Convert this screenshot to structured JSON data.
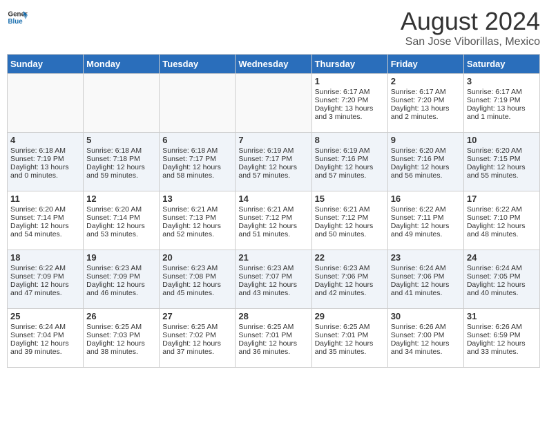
{
  "logo": {
    "general": "General",
    "blue": "Blue"
  },
  "title": "August 2024",
  "subtitle": "San Jose Viborillas, Mexico",
  "headers": [
    "Sunday",
    "Monday",
    "Tuesday",
    "Wednesday",
    "Thursday",
    "Friday",
    "Saturday"
  ],
  "weeks": [
    [
      {
        "day": "",
        "text": ""
      },
      {
        "day": "",
        "text": ""
      },
      {
        "day": "",
        "text": ""
      },
      {
        "day": "",
        "text": ""
      },
      {
        "day": "1",
        "text": "Sunrise: 6:17 AM\nSunset: 7:20 PM\nDaylight: 13 hours\nand 3 minutes."
      },
      {
        "day": "2",
        "text": "Sunrise: 6:17 AM\nSunset: 7:20 PM\nDaylight: 13 hours\nand 2 minutes."
      },
      {
        "day": "3",
        "text": "Sunrise: 6:17 AM\nSunset: 7:19 PM\nDaylight: 13 hours\nand 1 minute."
      }
    ],
    [
      {
        "day": "4",
        "text": "Sunrise: 6:18 AM\nSunset: 7:19 PM\nDaylight: 13 hours\nand 0 minutes."
      },
      {
        "day": "5",
        "text": "Sunrise: 6:18 AM\nSunset: 7:18 PM\nDaylight: 12 hours\nand 59 minutes."
      },
      {
        "day": "6",
        "text": "Sunrise: 6:18 AM\nSunset: 7:17 PM\nDaylight: 12 hours\nand 58 minutes."
      },
      {
        "day": "7",
        "text": "Sunrise: 6:19 AM\nSunset: 7:17 PM\nDaylight: 12 hours\nand 57 minutes."
      },
      {
        "day": "8",
        "text": "Sunrise: 6:19 AM\nSunset: 7:16 PM\nDaylight: 12 hours\nand 57 minutes."
      },
      {
        "day": "9",
        "text": "Sunrise: 6:20 AM\nSunset: 7:16 PM\nDaylight: 12 hours\nand 56 minutes."
      },
      {
        "day": "10",
        "text": "Sunrise: 6:20 AM\nSunset: 7:15 PM\nDaylight: 12 hours\nand 55 minutes."
      }
    ],
    [
      {
        "day": "11",
        "text": "Sunrise: 6:20 AM\nSunset: 7:14 PM\nDaylight: 12 hours\nand 54 minutes."
      },
      {
        "day": "12",
        "text": "Sunrise: 6:20 AM\nSunset: 7:14 PM\nDaylight: 12 hours\nand 53 minutes."
      },
      {
        "day": "13",
        "text": "Sunrise: 6:21 AM\nSunset: 7:13 PM\nDaylight: 12 hours\nand 52 minutes."
      },
      {
        "day": "14",
        "text": "Sunrise: 6:21 AM\nSunset: 7:12 PM\nDaylight: 12 hours\nand 51 minutes."
      },
      {
        "day": "15",
        "text": "Sunrise: 6:21 AM\nSunset: 7:12 PM\nDaylight: 12 hours\nand 50 minutes."
      },
      {
        "day": "16",
        "text": "Sunrise: 6:22 AM\nSunset: 7:11 PM\nDaylight: 12 hours\nand 49 minutes."
      },
      {
        "day": "17",
        "text": "Sunrise: 6:22 AM\nSunset: 7:10 PM\nDaylight: 12 hours\nand 48 minutes."
      }
    ],
    [
      {
        "day": "18",
        "text": "Sunrise: 6:22 AM\nSunset: 7:09 PM\nDaylight: 12 hours\nand 47 minutes."
      },
      {
        "day": "19",
        "text": "Sunrise: 6:23 AM\nSunset: 7:09 PM\nDaylight: 12 hours\nand 46 minutes."
      },
      {
        "day": "20",
        "text": "Sunrise: 6:23 AM\nSunset: 7:08 PM\nDaylight: 12 hours\nand 45 minutes."
      },
      {
        "day": "21",
        "text": "Sunrise: 6:23 AM\nSunset: 7:07 PM\nDaylight: 12 hours\nand 43 minutes."
      },
      {
        "day": "22",
        "text": "Sunrise: 6:23 AM\nSunset: 7:06 PM\nDaylight: 12 hours\nand 42 minutes."
      },
      {
        "day": "23",
        "text": "Sunrise: 6:24 AM\nSunset: 7:06 PM\nDaylight: 12 hours\nand 41 minutes."
      },
      {
        "day": "24",
        "text": "Sunrise: 6:24 AM\nSunset: 7:05 PM\nDaylight: 12 hours\nand 40 minutes."
      }
    ],
    [
      {
        "day": "25",
        "text": "Sunrise: 6:24 AM\nSunset: 7:04 PM\nDaylight: 12 hours\nand 39 minutes."
      },
      {
        "day": "26",
        "text": "Sunrise: 6:25 AM\nSunset: 7:03 PM\nDaylight: 12 hours\nand 38 minutes."
      },
      {
        "day": "27",
        "text": "Sunrise: 6:25 AM\nSunset: 7:02 PM\nDaylight: 12 hours\nand 37 minutes."
      },
      {
        "day": "28",
        "text": "Sunrise: 6:25 AM\nSunset: 7:01 PM\nDaylight: 12 hours\nand 36 minutes."
      },
      {
        "day": "29",
        "text": "Sunrise: 6:25 AM\nSunset: 7:01 PM\nDaylight: 12 hours\nand 35 minutes."
      },
      {
        "day": "30",
        "text": "Sunrise: 6:26 AM\nSunset: 7:00 PM\nDaylight: 12 hours\nand 34 minutes."
      },
      {
        "day": "31",
        "text": "Sunrise: 6:26 AM\nSunset: 6:59 PM\nDaylight: 12 hours\nand 33 minutes."
      }
    ]
  ]
}
